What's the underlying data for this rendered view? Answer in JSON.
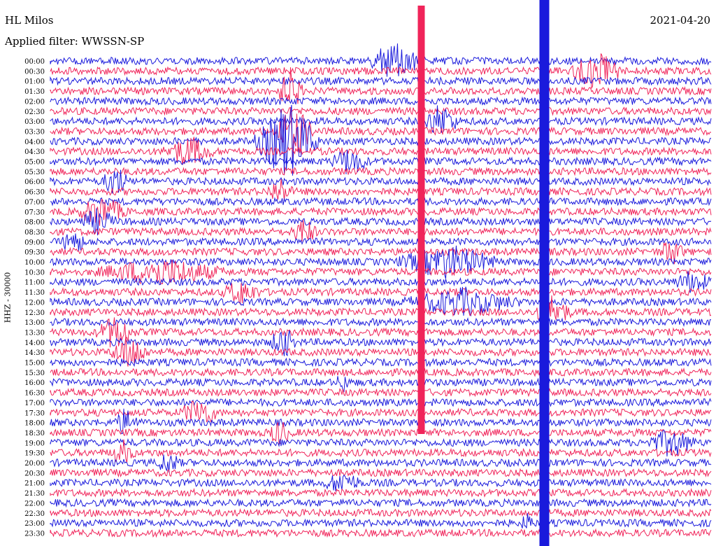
{
  "header": {
    "station": "HL Milos",
    "filter": "Applied filter: WWSSN-SP",
    "date": "2021-04-20"
  },
  "chart_data": {
    "type": "line",
    "title": "HL Milos",
    "subtitle": "Applied filter: WWSSN-SP",
    "ylabel": "HHZ - 30000",
    "row_labels": [
      "00:00",
      "00:30",
      "01:00",
      "01:30",
      "02:00",
      "02:30",
      "03:00",
      "03:30",
      "04:00",
      "04:30",
      "05:00",
      "05:30",
      "06:00",
      "06:30",
      "07:00",
      "07:30",
      "08:00",
      "08:30",
      "09:00",
      "09:30",
      "10:00",
      "10:30",
      "11:00",
      "11:30",
      "12:00",
      "12:30",
      "13:00",
      "13:30",
      "14:00",
      "14:30",
      "15:00",
      "15:30",
      "16:00",
      "16:30",
      "17:00",
      "17:30",
      "18:00",
      "18:30",
      "19:00",
      "19:30",
      "20:00",
      "20:30",
      "21:00",
      "21:30",
      "22:00",
      "22:30",
      "23:00",
      "23:30"
    ],
    "series_colors": [
      "#1a1adc",
      "#f0245a"
    ],
    "grid": false
  }
}
